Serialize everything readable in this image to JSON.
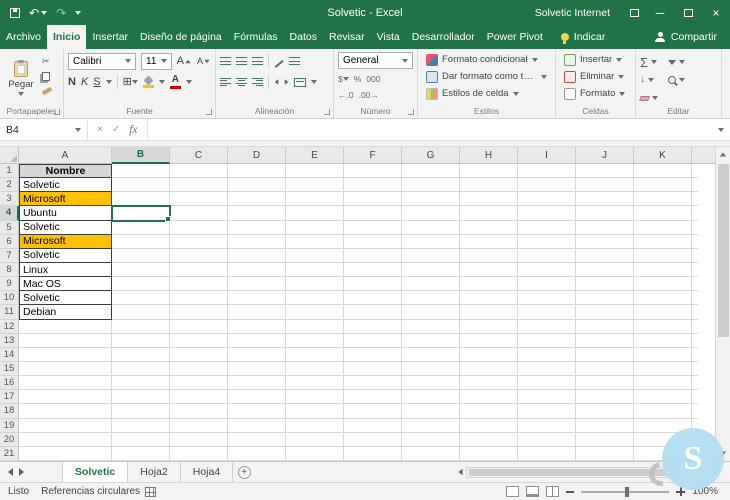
{
  "colors": {
    "accent": "#217346",
    "highlight_fill": "#ffc000",
    "header_fill": "#d6d6d6",
    "font_color_swatch": "#c00000"
  },
  "icons": {
    "cut": "✂",
    "undo": "↶",
    "redo": "↷",
    "sigma": "Σ",
    "borders": "⊞",
    "currency": "$",
    "percent": "%",
    "thousands": "000",
    "decimal_increase": "←.0",
    "decimal_decrease": ".00→",
    "check": "✓",
    "cancel": "×",
    "minimize": "─",
    "close": "×",
    "fill_down": "↓",
    "plus": "+",
    "font_letter": "A"
  },
  "title_bar": {
    "title": "Solvetic - Excel",
    "account": "Solvetic Internet"
  },
  "ribbon_tabs": [
    {
      "label": "Archivo"
    },
    {
      "label": "Inicio",
      "active": true
    },
    {
      "label": "Insertar"
    },
    {
      "label": "Diseño de página"
    },
    {
      "label": "Fórmulas"
    },
    {
      "label": "Datos"
    },
    {
      "label": "Revisar"
    },
    {
      "label": "Vista"
    },
    {
      "label": "Desarrollador"
    },
    {
      "label": "Power Pivot"
    }
  ],
  "tell_me": "Indicar",
  "share_label": "Compartir",
  "ribbon": {
    "clipboard": {
      "label": "Portapapeles",
      "paste_label": "Pegar"
    },
    "font": {
      "label": "Fuente",
      "name": "Calibri",
      "size": "11",
      "bold": "N",
      "italic": "K",
      "underline": "S"
    },
    "alignment": {
      "label": "Alineación"
    },
    "number": {
      "label": "Número",
      "format": "General"
    },
    "styles": {
      "label": "Estilos",
      "items": [
        "Formato condicional",
        "Dar formato como tabla",
        "Estilos de celda"
      ]
    },
    "cells": {
      "label": "Celdas",
      "items": [
        "Insertar",
        "Eliminar",
        "Formato"
      ]
    },
    "editing": {
      "label": "Editar"
    }
  },
  "formula_bar": {
    "name_box": "B4",
    "fx_label": "fx",
    "value": ""
  },
  "grid": {
    "columns": [
      "A",
      "B",
      "C",
      "D",
      "E",
      "F",
      "G",
      "H",
      "I",
      "J",
      "K"
    ],
    "rows": 21,
    "selection": {
      "col": "B",
      "row": 4
    },
    "cells": [
      {
        "ref": "A1",
        "text": "Nombre",
        "style": "title"
      },
      {
        "ref": "A2",
        "text": "Solvetic",
        "style": "data"
      },
      {
        "ref": "A3",
        "text": "Microsoft",
        "style": "data highlight"
      },
      {
        "ref": "A4",
        "text": "Ubuntu",
        "style": "data"
      },
      {
        "ref": "A5",
        "text": "Solvetic",
        "style": "data"
      },
      {
        "ref": "A6",
        "text": "Microsoft",
        "style": "data highlight"
      },
      {
        "ref": "A7",
        "text": "Solvetic",
        "style": "data"
      },
      {
        "ref": "A8",
        "text": "Linux",
        "style": "data"
      },
      {
        "ref": "A9",
        "text": "Mac OS",
        "style": "data"
      },
      {
        "ref": "A10",
        "text": "Solvetic",
        "style": "data"
      },
      {
        "ref": "A11",
        "text": "Debian",
        "style": "data"
      }
    ]
  },
  "sheet_tabs": [
    {
      "label": "Solvetic",
      "active": true
    },
    {
      "label": "Hoja2"
    },
    {
      "label": "Hoja4"
    }
  ],
  "status_bar": {
    "mode": "Listo",
    "message": "Referencias circulares",
    "zoom": "100%"
  },
  "watermark": {
    "letter": "S"
  }
}
